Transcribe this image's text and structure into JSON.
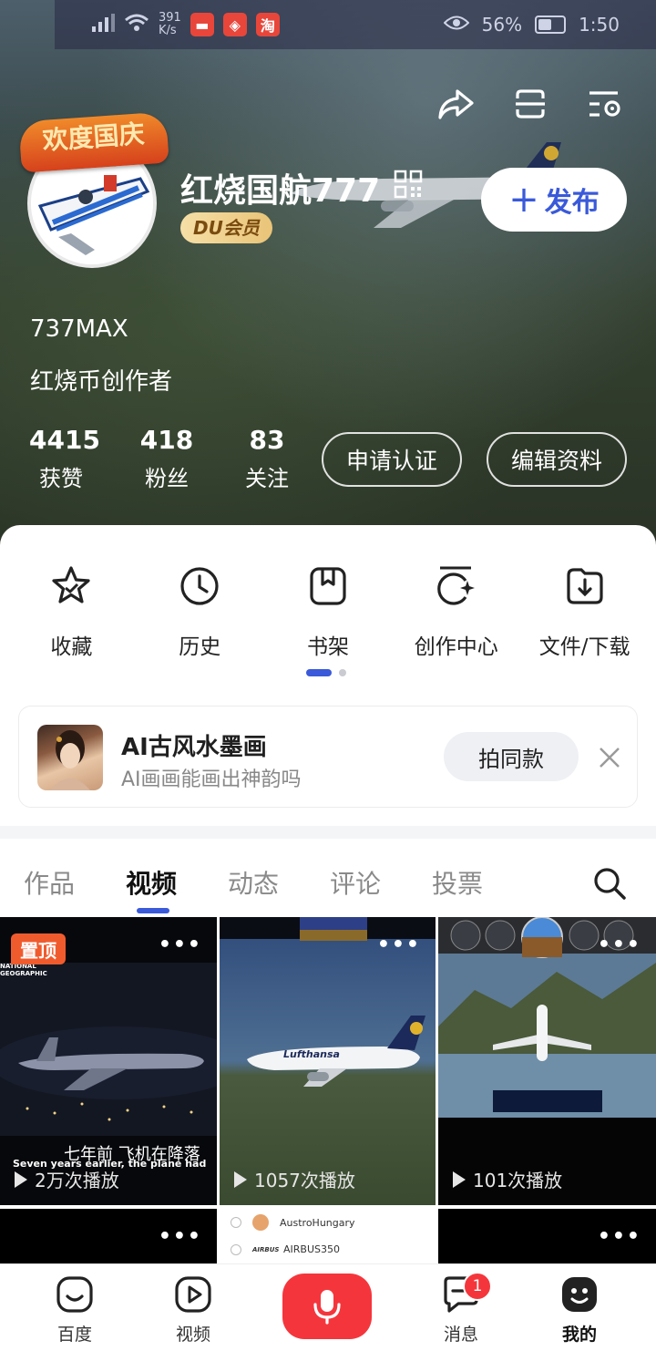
{
  "status_bar": {
    "network_speed": "391\nK/s",
    "battery": "56%",
    "time": "1:50"
  },
  "profile": {
    "avatar_ribbon": "欢度国庆",
    "name": "红烧国航777",
    "vip_badge": "DU会员",
    "publish_label": "发布",
    "bio_line1": "737MAX",
    "bio_line2": "红烧币创作者"
  },
  "stats": [
    {
      "value": "4415",
      "label": "获赞"
    },
    {
      "value": "418",
      "label": "粉丝"
    },
    {
      "value": "83",
      "label": "关注"
    }
  ],
  "profile_buttons": {
    "verify": "申请认证",
    "edit": "编辑资料"
  },
  "shortcuts": [
    {
      "label": "收藏",
      "icon": "star-icon"
    },
    {
      "label": "历史",
      "icon": "clock-icon"
    },
    {
      "label": "书架",
      "icon": "bookshelf-icon"
    },
    {
      "label": "创作中心",
      "icon": "creator-center-icon"
    },
    {
      "label": "文件/下载",
      "icon": "download-icon"
    }
  ],
  "promo": {
    "title": "AI古风水墨画",
    "subtitle": "AI画画能画出神韵吗",
    "button": "拍同款"
  },
  "tabs": [
    "作品",
    "视频",
    "动态",
    "评论",
    "投票"
  ],
  "active_tab": "视频",
  "videos": [
    {
      "pinned_label": "置顶",
      "caption_cn": "七年前 飞机在降落",
      "caption_en": "Seven years earlier, the plane had",
      "plays": "2万次播放",
      "watermark": "NATIONAL\nGEOGRAPHIC"
    },
    {
      "plays": "1057次播放",
      "livery": "Lufthansa"
    },
    {
      "plays": "101次播放"
    },
    {},
    {
      "list_rows": [
        "AustroHungary",
        "AIRBUS350"
      ],
      "list_brand": "AIRBUS"
    },
    {}
  ],
  "bottom_nav": [
    {
      "label": "百度",
      "icon": "baidu-home-icon"
    },
    {
      "label": "视频",
      "icon": "video-icon"
    },
    {
      "label": "",
      "icon": "microphone-icon"
    },
    {
      "label": "消息",
      "icon": "message-icon",
      "badge": "1"
    },
    {
      "label": "我的",
      "icon": "profile-icon"
    }
  ],
  "colors": {
    "accent": "#3a5ad9",
    "mic_red": "#f4363c",
    "pin_orange": "#f05b2e",
    "vip_gold": "#e9c478"
  }
}
